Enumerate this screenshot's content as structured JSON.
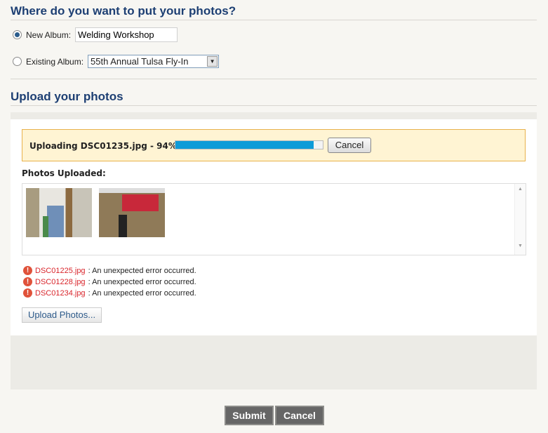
{
  "where": {
    "title": "Where do you want to put your photos?",
    "new_album_label": "New Album:",
    "new_album_value": "Welding Workshop",
    "existing_album_label": "Existing Album:",
    "existing_album_value": "55th Annual Tulsa Fly-In"
  },
  "upload": {
    "title": "Upload your photos",
    "status_text": "Uploading DSC01235.jpg - 94%",
    "progress_percent": 94,
    "cancel_label": "Cancel",
    "photos_uploaded_label": "Photos Uploaded:",
    "errors": [
      {
        "file": "DSC01225.jpg",
        "message": ": An unexpected error occurred."
      },
      {
        "file": "DSC01228.jpg",
        "message": ": An unexpected error occurred."
      },
      {
        "file": "DSC01234.jpg",
        "message": ": An unexpected error occurred."
      }
    ],
    "upload_button": "Upload Photos..."
  },
  "footer": {
    "submit": "Submit",
    "cancel": "Cancel"
  },
  "colors": {
    "heading": "#1d3f73",
    "progress": "#0e9bd8",
    "error": "#d9252b",
    "status_bg": "#fff4d3"
  }
}
